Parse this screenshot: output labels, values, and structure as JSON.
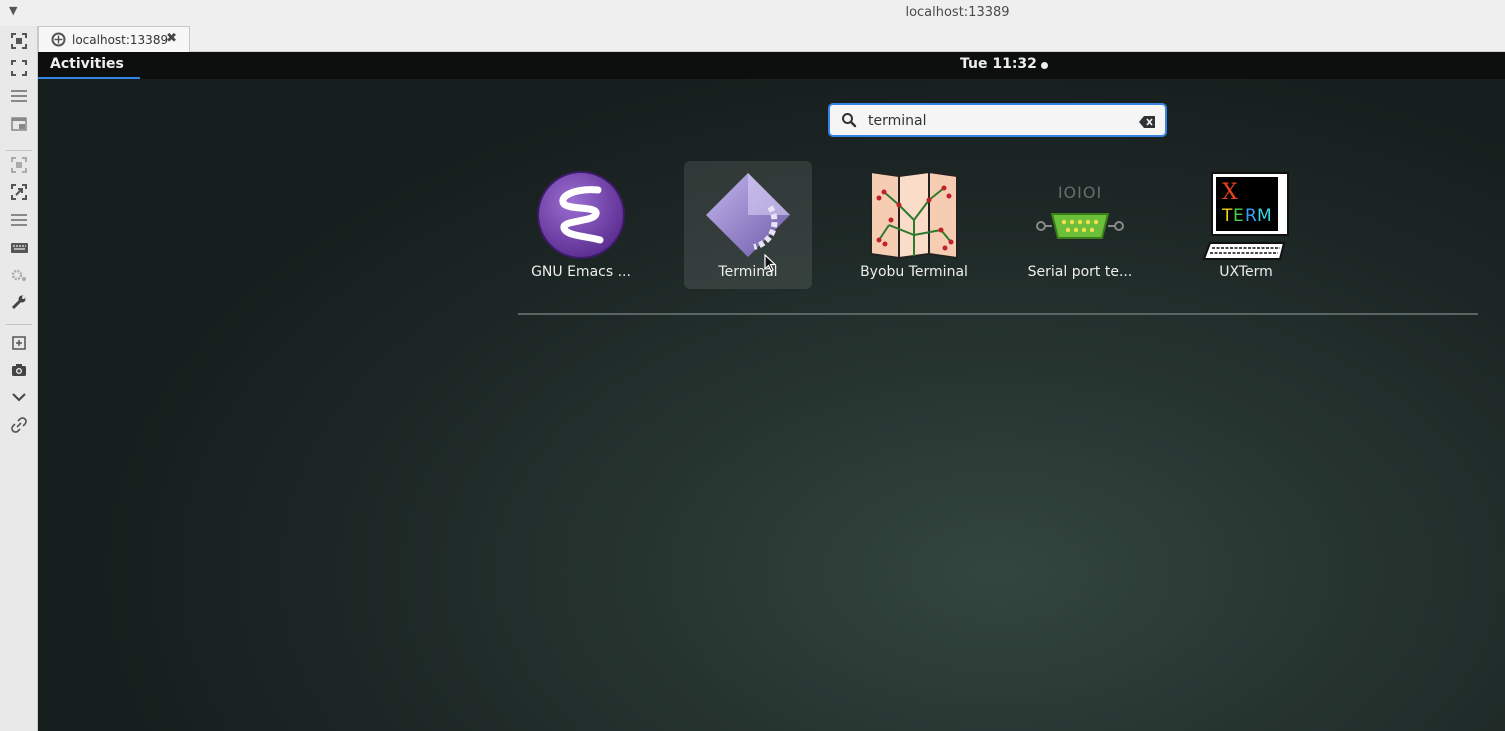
{
  "window": {
    "title": "localhost:13389",
    "menu_icon": "menu-arrow-icon"
  },
  "toolbar": {
    "buttons": [
      "fit-screen-icon",
      "fullscreen-icon",
      "hamburger-icon",
      "window-mode-icon",
      "select-icon",
      "expand-icon",
      "list-icon",
      "keyboard-icon",
      "settings-icon",
      "wrench-icon",
      "new-window-icon",
      "camera-icon",
      "chevron-down-icon",
      "link-icon"
    ]
  },
  "tab": {
    "label": "localhost:13389",
    "close": "✖"
  },
  "gnome": {
    "activities": "Activities",
    "clock": "Tue 11:32",
    "search": {
      "value": "terminal",
      "placeholder": ""
    },
    "apps": [
      {
        "label": "GNU Emacs ...",
        "icon": "emacs-icon"
      },
      {
        "label": "Terminal",
        "icon": "terminal-icon",
        "selected": true
      },
      {
        "label": "Byobu Terminal",
        "icon": "byobu-icon"
      },
      {
        "label": "Serial port te...",
        "icon": "serial-port-icon"
      },
      {
        "label": "UXTerm",
        "icon": "uxterm-icon"
      }
    ],
    "accent_color": "#3584e4"
  }
}
